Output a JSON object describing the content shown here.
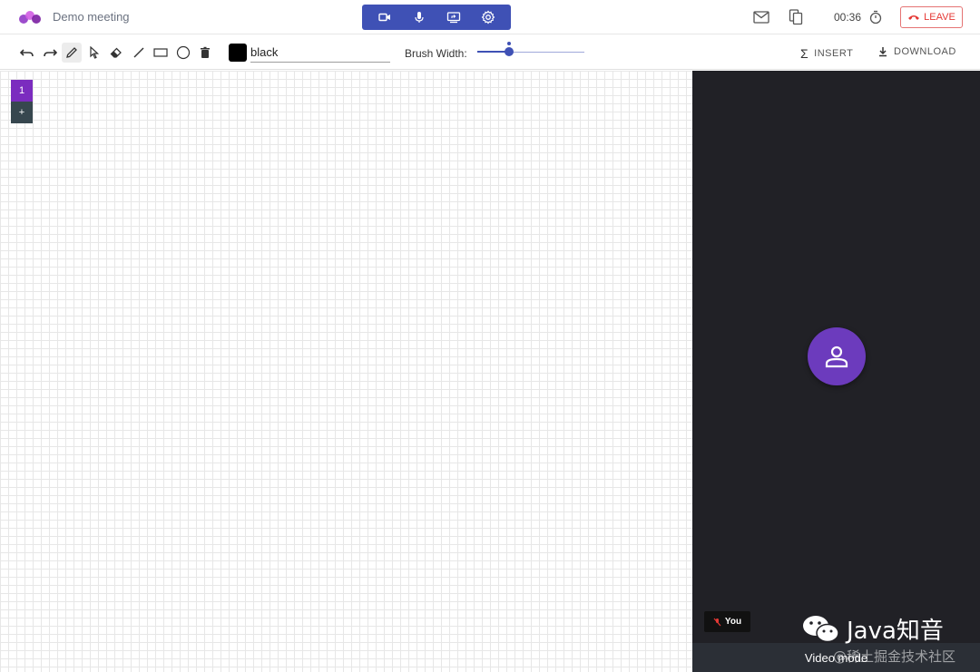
{
  "header": {
    "meeting_title": "Demo meeting",
    "timer": "00:36",
    "leave_label": "LEAVE"
  },
  "toolbar": {
    "color_value": "black",
    "brush_width_label": "Brush Width:",
    "brush_width_value": 0.3,
    "insert_label": "INSERT",
    "download_label": "DOWNLOAD"
  },
  "pages": {
    "current_label": "1",
    "add_label": "+"
  },
  "video": {
    "participant_label": "You",
    "mode_label": "Video mode"
  },
  "watermark": {
    "text": "Java知音",
    "sub": "@稀土掘金技术社区"
  },
  "colors": {
    "accent": "#3f51b5",
    "leave": "#e53935",
    "avatar": "#6c3bbd",
    "page_active": "#7b2cbf",
    "panel_bg": "#212126"
  }
}
